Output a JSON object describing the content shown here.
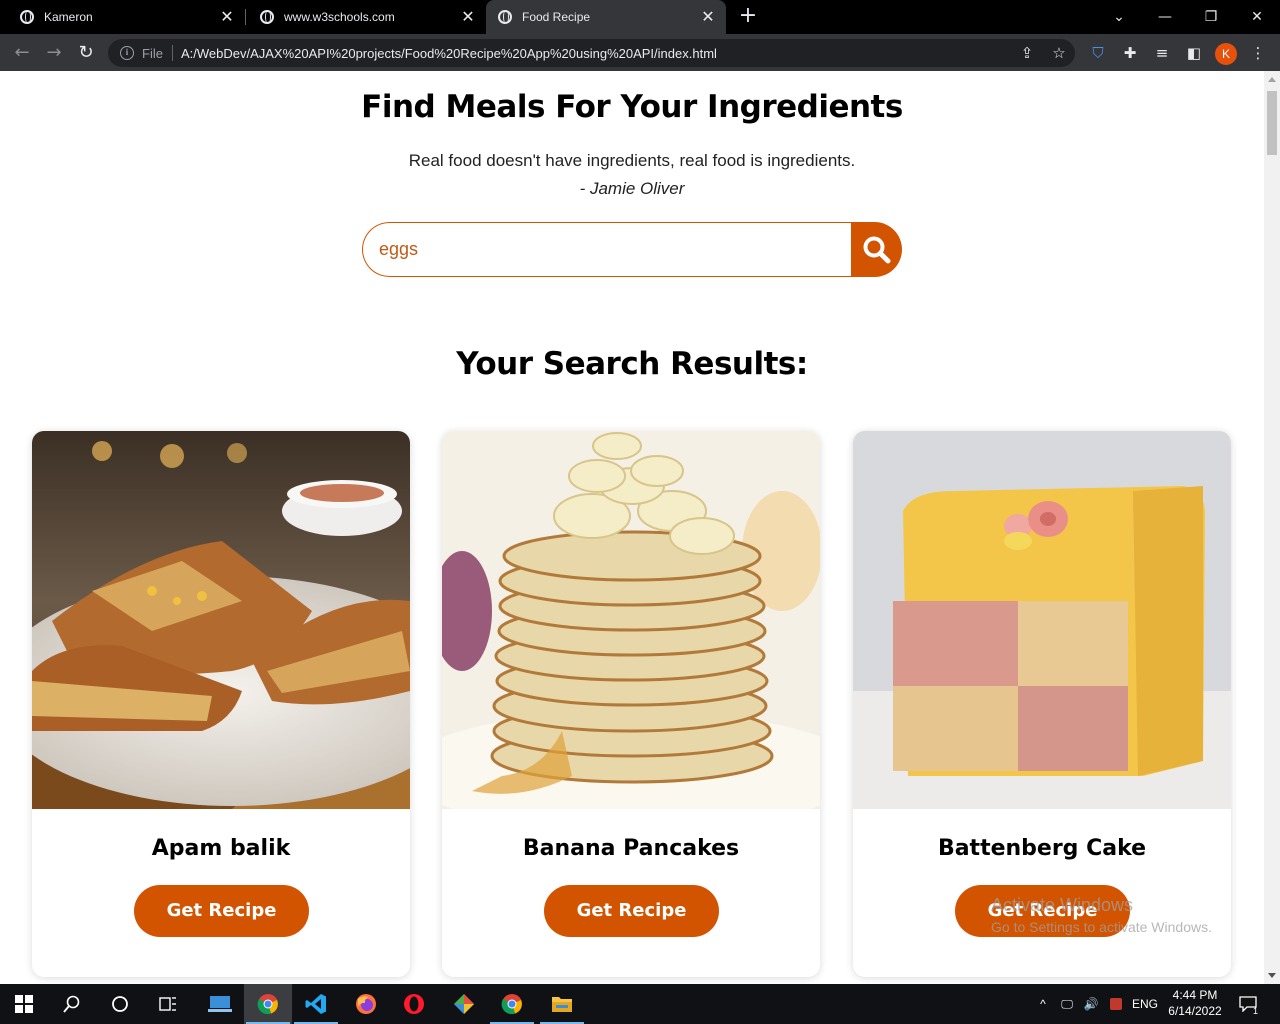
{
  "browser": {
    "tabs": [
      {
        "title": "Kameron",
        "active": false
      },
      {
        "title": "www.w3schools.com",
        "active": false
      },
      {
        "title": "Food Recipe",
        "active": true
      }
    ],
    "address": {
      "scheme_label": "File",
      "url": "A:/WebDev/AJAX%20API%20projects/Food%20Recipe%20App%20using%20API/index.html"
    },
    "profile_initial": "K"
  },
  "page": {
    "heading": "Find Meals For Your Ingredients",
    "quote": "Real food doesn't have ingredients, real food is ingredients.",
    "quote_author": "- Jamie Oliver",
    "search": {
      "value": "eggs"
    },
    "results_heading": "Your Search Results:",
    "meals": [
      {
        "name": "Apam balik",
        "button_label": "Get Recipe"
      },
      {
        "name": "Banana Pancakes",
        "button_label": "Get Recipe"
      },
      {
        "name": "Battenberg Cake",
        "button_label": "Get Recipe"
      }
    ],
    "accent_color": "#d35400"
  },
  "watermark": {
    "line1": "Activate Windows",
    "line2": "Go to Settings to activate Windows."
  },
  "taskbar": {
    "language": "ENG",
    "time": "4:44 PM",
    "date": "6/14/2022",
    "notification_count": "1",
    "apps": [
      "start-icon",
      "search-icon",
      "cortana-icon",
      "task-view-icon",
      "vm-icon",
      "chrome-icon",
      "vscode-icon",
      "firefox-icon",
      "opera-icon",
      "git-icon",
      "chrome-icon",
      "file-explorer-icon"
    ]
  }
}
